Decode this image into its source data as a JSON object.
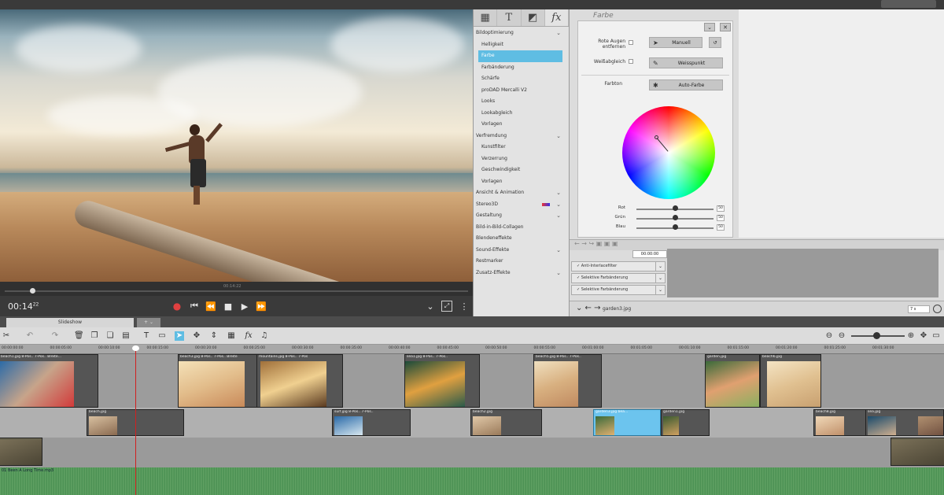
{
  "preview": {
    "timecode": "00:14",
    "timecode_frames": "22",
    "scrub_timecode": "00:14:22"
  },
  "effects": {
    "tabs": [
      "▦",
      "T",
      "◩",
      "fx"
    ],
    "items": [
      {
        "label": "Bildoptimierung",
        "type": "cat",
        "expand": "⌄"
      },
      {
        "label": "Helligkeit",
        "type": "item"
      },
      {
        "label": "Farbe",
        "type": "sel"
      },
      {
        "label": "Farbänderung",
        "type": "item"
      },
      {
        "label": "Schärfe",
        "type": "item"
      },
      {
        "label": "proDAD Mercalli V2",
        "type": "item"
      },
      {
        "label": "Looks",
        "type": "item"
      },
      {
        "label": "Lookabgleich",
        "type": "item"
      },
      {
        "label": "Vorlagen",
        "type": "item"
      },
      {
        "label": "Verfremdung",
        "type": "cat",
        "expand": "⌄"
      },
      {
        "label": "Kunstfilter",
        "type": "item"
      },
      {
        "label": "Verzerrung",
        "type": "item"
      },
      {
        "label": "Geschwindigkeit",
        "type": "item"
      },
      {
        "label": "Vorlagen",
        "type": "item"
      },
      {
        "label": "Ansicht & Animation",
        "type": "cat",
        "expand": "⌄"
      },
      {
        "label": "Stereo3D",
        "type": "cat",
        "expand": "⌄"
      },
      {
        "label": "Gestaltung",
        "type": "cat",
        "expand": "⌄"
      },
      {
        "label": "Bild-in-Bild-Collagen",
        "type": "cat"
      },
      {
        "label": "Blendeneffekte",
        "type": "cat"
      },
      {
        "label": "Sound-Effekte",
        "type": "cat",
        "expand": "⌄"
      },
      {
        "label": "Restmarker",
        "type": "cat"
      },
      {
        "label": "Zusatz-Effekte",
        "type": "cat",
        "expand": "⌄"
      }
    ]
  },
  "props": {
    "title": "Farbe",
    "red_eye_label": "Rote Augen entfernen",
    "manual_button": "Manuell",
    "white_balance_label": "Weißabgleich",
    "white_point_button": "Weisspunkt",
    "color_tone_label": "Farbton",
    "auto_color_button": "Auto-Farbe",
    "sliders": [
      {
        "label": "Rot",
        "value": "50"
      },
      {
        "label": "Grün",
        "value": "50"
      },
      {
        "label": "Blau",
        "value": "50"
      }
    ]
  },
  "keyframes": {
    "time": "00:00:00",
    "rows": [
      "✓ Anti-Interlacefilter",
      "✓ Selektive Farbänderung",
      "✓ Selektive Farbänderung"
    ],
    "filename": "garden3.jpg",
    "duration": "7 s"
  },
  "timeline": {
    "tab_label": "Slideshow",
    "tab_add": "+ ⌄",
    "ruler": [
      "00:00:00:00",
      "00:00:05:00",
      "00:00:10:00",
      "00:00:15:00",
      "00:00:20:00",
      "00:00:25:00",
      "00:00:30:00",
      "00:00:35:00",
      "00:00:40:00",
      "00:00:45:00",
      "00:00:50:00",
      "00:00:55:00",
      "00:01:00:00",
      "00:01:05:00",
      "00:01:10:00",
      "00:01:15:00",
      "00:01:20:00",
      "00:01:25:00",
      "00:01:30:00"
    ],
    "audio_label": "01 Been A Long Time.mp3",
    "clips_t1": [
      {
        "label": "beach1.jpg  8-Pos.. 7-Pos.. Breite…"
      },
      {
        "label": "beach3.jpg  8-Pos.. 7-Pos.. Breite"
      },
      {
        "label": "mountains.jpg  8-Pos.. 7-Pos"
      },
      {
        "label": "sea1.jpg  8-Pos.. 7-Pos.."
      },
      {
        "label": "beach5.jpg  8-Pos.. 7-Pos.."
      },
      {
        "label": "garden.jpg"
      },
      {
        "label": "beach6.jpg"
      }
    ],
    "clips_t2": [
      {
        "label": "beach.jpg"
      },
      {
        "label": "surf.jpg  8-Pos.. 7-Pos.."
      },
      {
        "label": "beach2.jpg"
      },
      {
        "label": "garden3.jpg  bea…"
      },
      {
        "label": "garden1.jpg"
      },
      {
        "label": "beach8.jpg"
      },
      {
        "label": "sea.jpg"
      }
    ]
  }
}
